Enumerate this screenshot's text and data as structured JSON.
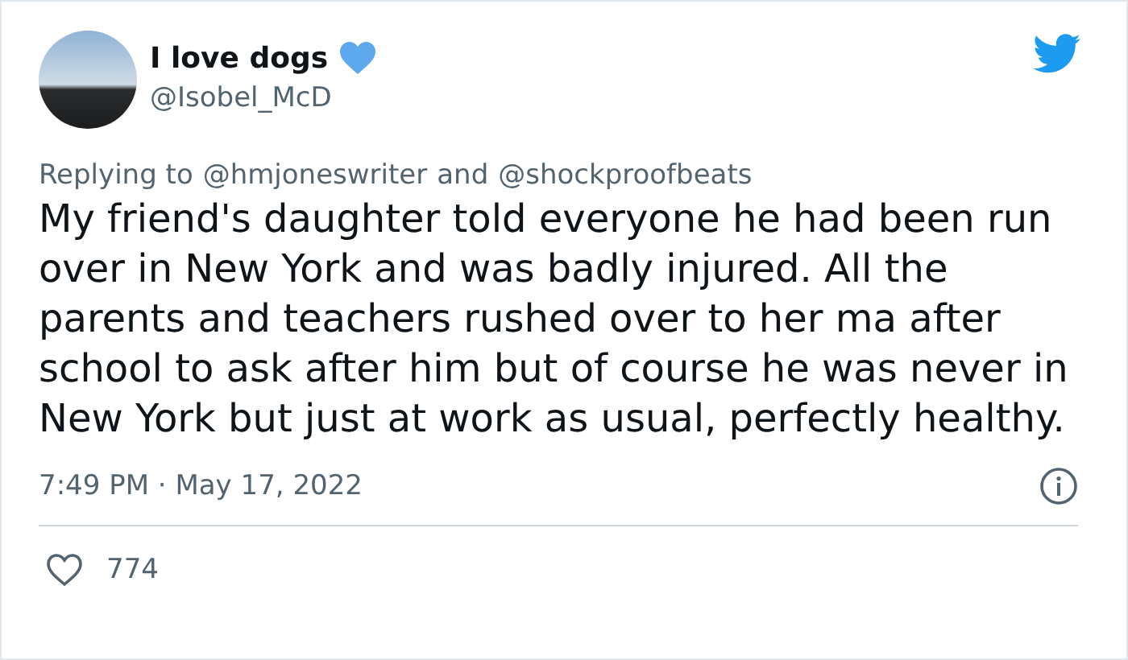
{
  "author": {
    "name": "I love dogs",
    "verified_heart": true,
    "handle": "@Isobel_McD"
  },
  "reply": {
    "prefix": "Replying to",
    "mentions": [
      "@hmjoneswriter",
      "@shockproofbeats"
    ],
    "joiner": "and"
  },
  "text": "My friend's daughter told everyone he had been run over in New York and was badly injured. All the parents and teachers rushed over to her ma after school to ask after him but of course he was never in New York but just at work as usual, perfectly healthy.",
  "timestamp": "7:49 PM · May 17, 2022",
  "likes": "774"
}
